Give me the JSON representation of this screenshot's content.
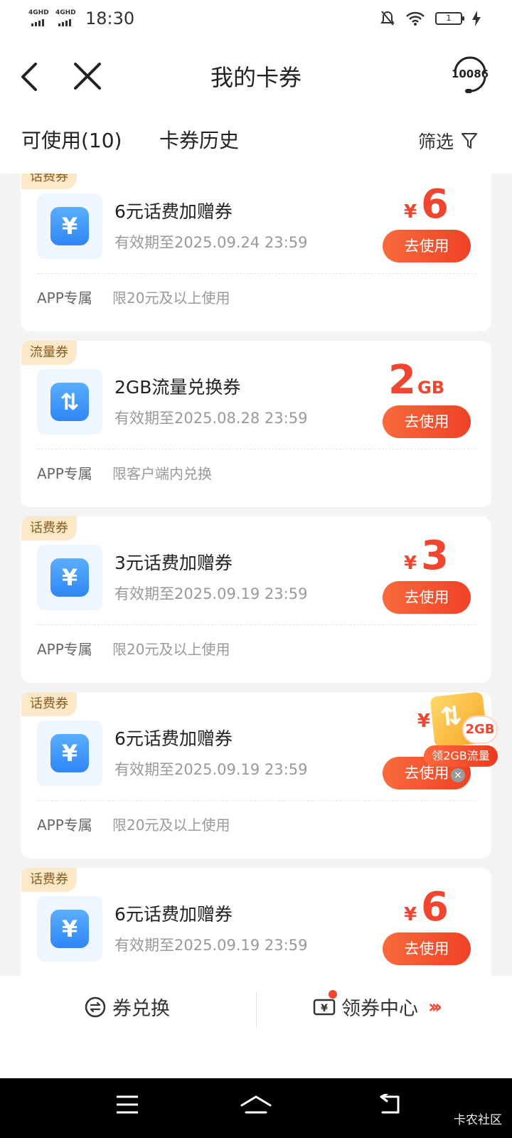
{
  "status_bar": {
    "network1": "4GHD",
    "network2": "4GHD",
    "time": "18:30",
    "battery": "1"
  },
  "nav": {
    "title": "我的卡券",
    "service": "10086"
  },
  "tabs": {
    "available": "可使用(10)",
    "history": "卡券历史",
    "filter": "筛选"
  },
  "coupons": [
    {
      "tag": "话费券",
      "icon": "yuan-icon",
      "icon_glyph": "¥",
      "name": "6元话费加赠券",
      "expiry": "有效期至2025.09.24 23:59",
      "currency": "¥",
      "value": "6",
      "unit": "",
      "button": "去使用",
      "channel": "APP专属",
      "condition": "限20元及以上使用"
    },
    {
      "tag": "流量券",
      "icon": "data-transfer-icon",
      "icon_glyph": "⇅",
      "name": "2GB流量兑换券",
      "expiry": "有效期至2025.08.28 23:59",
      "currency": "",
      "value": "2",
      "unit": "GB",
      "button": "去使用",
      "channel": "APP专属",
      "condition": "限客户端内兑换"
    },
    {
      "tag": "话费券",
      "icon": "yuan-icon",
      "icon_glyph": "¥",
      "name": "3元话费加赠券",
      "expiry": "有效期至2025.09.19 23:59",
      "currency": "¥",
      "value": "3",
      "unit": "",
      "button": "去使用",
      "channel": "APP专属",
      "condition": "限20元及以上使用"
    },
    {
      "tag": "话费券",
      "icon": "yuan-icon",
      "icon_glyph": "¥",
      "name": "6元话费加赠券",
      "expiry": "有效期至2025.09.19 23:59",
      "currency": "¥",
      "value": "",
      "unit": "",
      "button": "去使用",
      "channel": "APP专属",
      "condition": "限20元及以上使用"
    },
    {
      "tag": "话费券",
      "icon": "yuan-icon",
      "icon_glyph": "¥",
      "name": "6元话费加赠券",
      "expiry": "有效期至2025.09.19 23:59",
      "currency": "¥",
      "value": "6",
      "unit": "",
      "button": "去使用",
      "channel": "",
      "condition": ""
    }
  ],
  "promo": {
    "badge": "2GB",
    "label": "领2GB流量"
  },
  "bottom_bar": {
    "exchange": "券兑换",
    "center": "领券中心"
  },
  "watermark": "卡农社区",
  "colors": {
    "accent": "#f0452f",
    "tag_bg": "#fde8c8",
    "icon_blue": "#3a8ef7"
  }
}
